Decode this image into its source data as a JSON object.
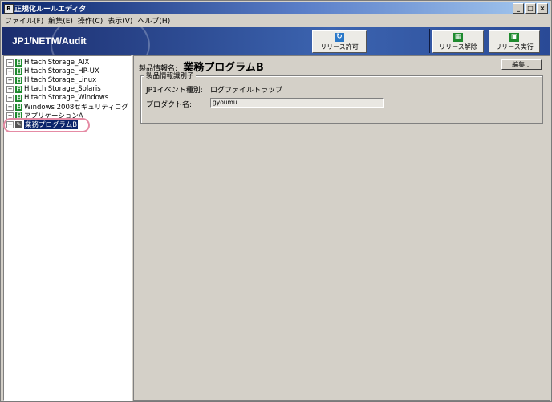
{
  "window": {
    "title": "正規化ルールエディタ",
    "controls": [
      "_",
      "□",
      "×"
    ]
  },
  "menu": [
    "ファイル(F)",
    "編集(E)",
    "操作(C)",
    "表示(V)",
    "ヘルプ(H)"
  ],
  "banner": {
    "brand": "JP1/NETM/Audit",
    "buttons": {
      "release_permit": "リリース許可",
      "release_cancel": "リリース解除",
      "release_run": "リリース実行"
    }
  },
  "tree": {
    "items": [
      {
        "label": "HitachiStorage_AIX"
      },
      {
        "label": "HitachiStorage_HP-UX"
      },
      {
        "label": "HitachiStorage_Linux"
      },
      {
        "label": "HitachiStorage_Solaris"
      },
      {
        "label": "HitachiStorage_Windows"
      },
      {
        "label": "Windows 2008セキュリティログ"
      },
      {
        "label": "アプリケーションA"
      },
      {
        "label": "業務プログラムB"
      }
    ]
  },
  "detail": {
    "product_label": "製品情報名:",
    "product_value": "業務プログラムB",
    "edit_button": "編集...",
    "group_title": "製品情報識別子",
    "event_type_label": "JP1イベント種別:",
    "event_type_value": "ログファイルトラップ",
    "product_name_label": "プロダクト名:",
    "product_name_value": "gyoumu"
  }
}
